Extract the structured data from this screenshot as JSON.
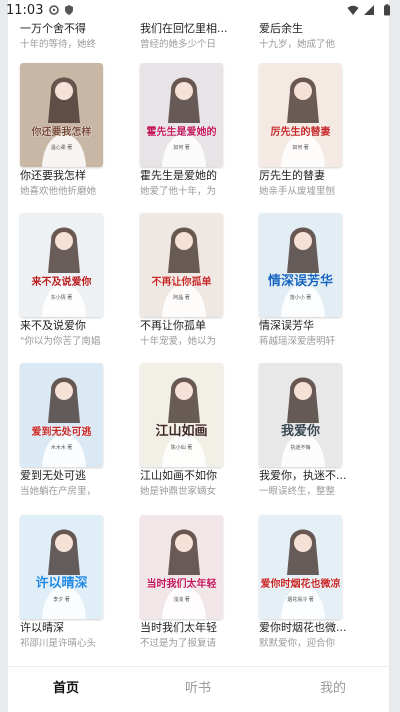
{
  "status_bar": {
    "time": "11:03"
  },
  "partial_row": [
    {
      "title": "一万个舍不得",
      "desc": "十年的等待，她终"
    },
    {
      "title": "我们在回忆里相...",
      "desc": "曾经的她多少个日"
    },
    {
      "title": "爱后余生",
      "desc": "十九岁，她成了他"
    }
  ],
  "books": [
    {
      "title": "你还要我怎样",
      "desc": "她喜欢他他折磨她",
      "cover_text": "你还要我怎样",
      "cover_author": "温心柔 著",
      "cover_bg": "#c9b7a6",
      "cover_accent": "#7a4a3a"
    },
    {
      "title": "霍先生是爱她的",
      "desc": "她爱了他十年，为",
      "cover_text": "霍先生是爱她的",
      "cover_author": "如何 著",
      "cover_bg": "#e8e3e6",
      "cover_accent": "#c2185b"
    },
    {
      "title": "厉先生的替妻",
      "desc": "她亲手从废墟里刨",
      "cover_text": "厉先生的替妻",
      "cover_author": "如何 著",
      "cover_bg": "#f5e9e4",
      "cover_accent": "#c62828"
    },
    {
      "title": "来不及说爱你",
      "desc": "\"你以为你苦了南娼",
      "cover_text": "来不及说爱你",
      "cover_author": "东小情 著",
      "cover_bg": "#eef1f4",
      "cover_accent": "#b71c1c"
    },
    {
      "title": "不再让你孤单",
      "desc": "十年宠爱，她以为",
      "cover_text": "不再让你孤单",
      "cover_author": "阿晶 著",
      "cover_bg": "#efe7e2",
      "cover_accent": "#c62828"
    },
    {
      "title": "情深误芳华",
      "desc": "蒋越瑶深爱唐明轩",
      "cover_text": "情深误芳华",
      "cover_author": "落小小 著",
      "cover_bg": "#e3eef4",
      "cover_accent": "#1565c0"
    },
    {
      "title": "爱到无处可逃",
      "desc": "当她躺在产房里，",
      "cover_text": "爱到无处可逃",
      "cover_author": "木木木 著",
      "cover_bg": "#dbe9f5",
      "cover_accent": "#c62828"
    },
    {
      "title": "江山如画不如你",
      "desc": "她是钟鼎世家嫡女",
      "cover_text": "江山如画",
      "cover_author": "陈小仙 著",
      "cover_bg": "#f2efe6",
      "cover_accent": "#3e2723"
    },
    {
      "title": "我爱你，执迷不...",
      "desc": "一眼误终生，整整",
      "cover_text": "我爱你",
      "cover_author": "执迷不悔",
      "cover_bg": "#e8e8e8",
      "cover_accent": "#37474f"
    },
    {
      "title": "许以晴深",
      "desc": "祁邵川是许晴心头",
      "cover_text": "许以晴深",
      "cover_author": "李夕 著",
      "cover_bg": "#dfeef7",
      "cover_accent": "#1e88e5"
    },
    {
      "title": "当时我们太年轻",
      "desc": "不过是为了报复请",
      "cover_text": "当时我们太年轻",
      "cover_author": "浅浅 著",
      "cover_bg": "#f3e6e9",
      "cover_accent": "#c2185b"
    },
    {
      "title": "爱你时烟花也微...",
      "desc": "默默爱你，迎合你",
      "cover_text": "爱你时烟花也微凉",
      "cover_author": "烟花易冷 著",
      "cover_bg": "#e4f0f6",
      "cover_accent": "#c62828"
    }
  ],
  "tabs": [
    {
      "label": "首页",
      "active": true
    },
    {
      "label": "听书",
      "active": false
    },
    {
      "label": "我的",
      "active": false
    }
  ]
}
